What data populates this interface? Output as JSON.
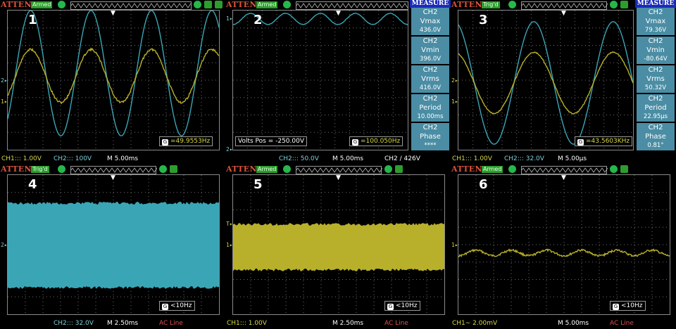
{
  "panels": [
    {
      "number": "1",
      "brand": "ATTEN",
      "status": "Armed",
      "footer": {
        "ch1": "CH1::: 1.00V",
        "ch2": "CH2::: 100V",
        "time": "M 5.00ms",
        "extra": ""
      },
      "freq": "=49.9553Hz",
      "waves": [
        {
          "channel": "CH2",
          "color": "#3aa6b5",
          "type": "sine",
          "amplitude": 0.45,
          "offset": 0.35,
          "cycles": 3.5,
          "phase": 0.1
        },
        {
          "channel": "CH1",
          "color": "#b8b02a",
          "type": "sine",
          "amplitude": 0.16,
          "offset": 0.38,
          "cycles": 3.5,
          "phase": 0.25
        }
      ]
    },
    {
      "number": "2",
      "brand": "ATTEN",
      "status": "Armed",
      "footer": {
        "ch1": "",
        "ch2": "CH2::: 50.0V",
        "time": "M 5.00ms",
        "extra": "CH2 / 426V"
      },
      "voltpos": "Volts Pos = -250.00V",
      "freq": "=100.050Hz",
      "measure": {
        "title": "MEASURE",
        "items": [
          {
            "ch": "CH2",
            "name": "Vmax",
            "value": "436.0V"
          },
          {
            "ch": "CH2",
            "name": "Vmin",
            "value": "396.0V"
          },
          {
            "ch": "CH2",
            "name": "Vrms",
            "value": "416.0V"
          },
          {
            "ch": "CH2",
            "name": "Period",
            "value": "10.00ms"
          },
          {
            "ch": "CH2",
            "name": "Phase",
            "value": "****"
          }
        ]
      }
    },
    {
      "number": "3",
      "brand": "ATTEN",
      "status": "Trig'd",
      "footer": {
        "ch1": "CH1::: 1.00V",
        "ch2": "CH2::: 32.0V",
        "time": "M 5.00µs",
        "extra": ""
      },
      "freq": "=43.5603KHz",
      "measure": {
        "title": "MEASURE",
        "items": [
          {
            "ch": "CH2",
            "name": "Vmax",
            "value": "79.36V"
          },
          {
            "ch": "CH2",
            "name": "Vmin",
            "value": "-80.64V"
          },
          {
            "ch": "CH2",
            "name": "Vrms",
            "value": "50.32V"
          },
          {
            "ch": "CH2",
            "name": "Period",
            "value": "22.95µs"
          },
          {
            "ch": "CH2",
            "name": "Phase",
            "value": "0.81°"
          }
        ]
      }
    },
    {
      "number": "4",
      "brand": "ATTEN",
      "status": "Trig'd",
      "footer": {
        "ch1": "",
        "ch2": "CH2::: 32.0V",
        "time": "M 2.50ms",
        "extra": "AC Line"
      },
      "freq": "<10Hz"
    },
    {
      "number": "5",
      "brand": "ATTEN",
      "status": "Armed",
      "footer": {
        "ch1": "CH1::: 1.00V",
        "ch2": "",
        "time": "M 2.50ms",
        "extra": "AC Line"
      },
      "freq": "<10Hz"
    },
    {
      "number": "6",
      "brand": "ATTEN",
      "status": "Armed",
      "footer": {
        "ch1": "CH1∼ 2.00mV",
        "ch2": "",
        "time": "M 5.00ms",
        "extra": "AC Line"
      },
      "freq": "<10Hz"
    }
  ],
  "colors": {
    "ch1": "#b8b02a",
    "ch2": "#3aa6b5",
    "brand": "#d9533a",
    "measure_bg": "#4a8da4",
    "measure_title": "#1a2ab8"
  },
  "icons": [
    "lock-icon",
    "trigger-icon",
    "memory-icon",
    "settings-icon"
  ]
}
